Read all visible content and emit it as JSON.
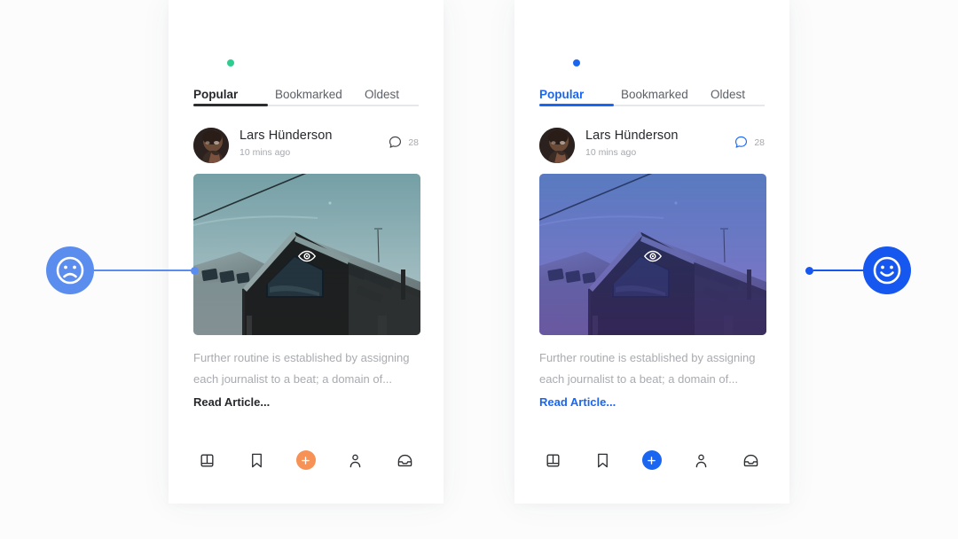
{
  "panels": [
    {
      "variant": "left",
      "accent_color": "#2b2d31",
      "dot_color": "#2ECC8F",
      "fab_color": "#F79256",
      "badge_color": "#5B8DEF",
      "tabs": [
        {
          "label": "Popular",
          "active": true
        },
        {
          "label": "Bookmarked",
          "active": false
        },
        {
          "label": "Oldest",
          "active": false
        }
      ],
      "post": {
        "author": "Lars Hünderson",
        "time": "10 mins ago",
        "comment_count": "28",
        "excerpt": "Further routine is established by assigning each journalist to a beat; a domain of...",
        "read_more": "Read Article..."
      },
      "nav": [
        {
          "icon": "book-icon",
          "label": "Library"
        },
        {
          "icon": "bookmark-icon",
          "label": "Bookmarks"
        },
        {
          "icon": "plus-icon",
          "label": "Create"
        },
        {
          "icon": "person-icon",
          "label": "Profile"
        },
        {
          "icon": "inbox-icon",
          "label": "Inbox"
        }
      ],
      "annotation": {
        "mood": "sad",
        "icon": "sad-face-icon"
      }
    },
    {
      "variant": "right",
      "accent_color": "#1A66F0",
      "dot_color": "#1A66F0",
      "fab_color": "#1A66F0",
      "badge_color": "#1657F0",
      "tabs": [
        {
          "label": "Popular",
          "active": true
        },
        {
          "label": "Bookmarked",
          "active": false
        },
        {
          "label": "Oldest",
          "active": false
        }
      ],
      "post": {
        "author": "Lars Hünderson",
        "time": "10 mins ago",
        "comment_count": "28",
        "excerpt": "Further routine is established by assigning each journalist to a beat; a domain of...",
        "read_more": "Read Article..."
      },
      "nav": [
        {
          "icon": "book-icon",
          "label": "Library"
        },
        {
          "icon": "bookmark-icon",
          "label": "Bookmarks"
        },
        {
          "icon": "plus-icon",
          "label": "Create"
        },
        {
          "icon": "person-icon",
          "label": "Profile"
        },
        {
          "icon": "inbox-icon",
          "label": "Inbox"
        }
      ],
      "annotation": {
        "mood": "happy",
        "icon": "happy-face-icon"
      }
    }
  ],
  "photo": {
    "icon": "eye-icon",
    "subject": "dark gabled house against sky"
  },
  "background_color": "#FCFCFC"
}
